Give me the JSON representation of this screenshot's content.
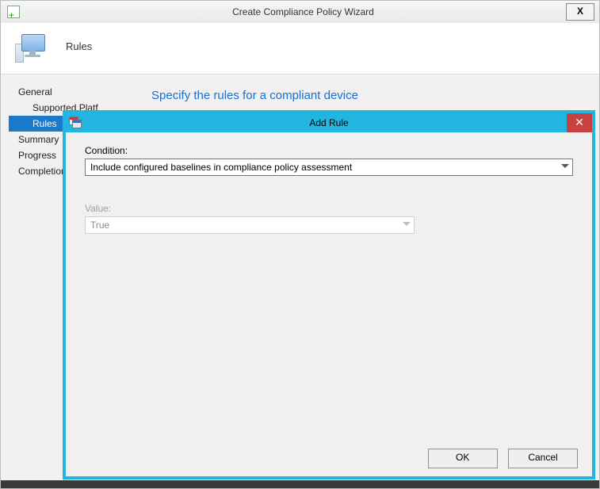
{
  "wizard": {
    "title": "Create Compliance Policy Wizard",
    "header_label": "Rules",
    "content_heading": "Specify the rules for a compliant device",
    "nav": {
      "general": "General",
      "supported_platforms": "Supported Platf",
      "rules": "Rules",
      "summary": "Summary",
      "progress": "Progress",
      "completion": "Completion"
    },
    "close_glyph": "X"
  },
  "dialog": {
    "title": "Add Rule",
    "close_glyph": "✕",
    "condition_label": "Condition:",
    "condition_value": "Include configured baselines in compliance policy assessment",
    "value_label": "Value:",
    "value_value": "True",
    "buttons": {
      "ok": "OK",
      "cancel": "Cancel"
    }
  }
}
